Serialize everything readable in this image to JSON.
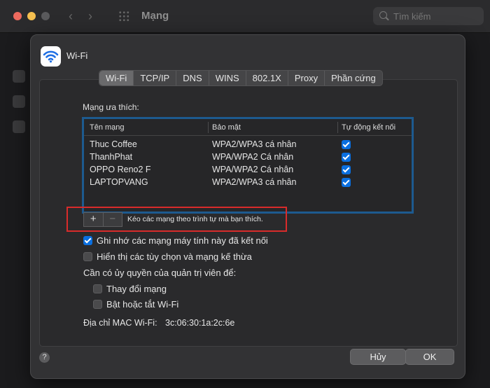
{
  "window": {
    "title": "Mạng",
    "search_placeholder": "Tìm kiếm"
  },
  "sheet": {
    "title": "Wi-Fi",
    "tabs": [
      {
        "label": "Wi-Fi",
        "active": true
      },
      {
        "label": "TCP/IP"
      },
      {
        "label": "DNS"
      },
      {
        "label": "WINS"
      },
      {
        "label": "802.1X"
      },
      {
        "label": "Proxy"
      },
      {
        "label": "Phần cứng"
      }
    ],
    "preferred_label": "Mạng ưa thích:",
    "table": {
      "headers": [
        "Tên mạng",
        "Bảo mật",
        "Tự động kết nối"
      ],
      "rows": [
        {
          "name": "Thuc Coffee",
          "security": "WPA2/WPA3 cá nhân",
          "auto": true
        },
        {
          "name": "ThanhPhat",
          "security": "WPA/WPA2 Cá nhân",
          "auto": true
        },
        {
          "name": "OPPO Reno2 F",
          "security": "WPA/WPA2 Cá nhân",
          "auto": true
        },
        {
          "name": "LAPTOPVANG",
          "security": "WPA2/WPA3 cá nhân",
          "auto": true
        }
      ]
    },
    "plus_label": "+",
    "minus_label": "−",
    "drag_hint": "Kéo các mạng theo trình tự mà bạn thích.",
    "remember_label": "Ghi nhớ các mạng máy tính này đã kết nối",
    "remember_checked": true,
    "legacy_label": "Hiển thị các tùy chọn và mạng kế thừa",
    "legacy_checked": false,
    "admin_label": "Cần có ủy quyền của quản trị viên để:",
    "change_network_label": "Thay đổi mạng",
    "toggle_wifi_label": "Bật hoặc tắt Wi-Fi",
    "mac_label": "Địa chỉ MAC Wi-Fi:",
    "mac_value": "3c:06:30:1a:2c:6e",
    "help_label": "?",
    "cancel_label": "Hủy",
    "ok_label": "OK"
  },
  "colors": {
    "highlight_table": "#1d5a8f",
    "annotation_red": "#d92b2b",
    "checkbox_blue": "#0a6fe0"
  }
}
